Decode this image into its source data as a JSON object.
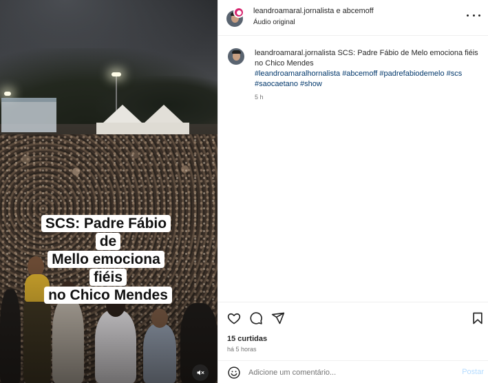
{
  "media": {
    "overlay_caption_lines": [
      "SCS: Padre Fábio de",
      "Mello emociona fiéis",
      "no Chico Mendes"
    ],
    "mute_icon": "speaker-muted-icon"
  },
  "header": {
    "authors": "leandroamaral.jornalista e abcemoff",
    "audio": "Áudio original",
    "more_icon": "more-horizontal-icon"
  },
  "post": {
    "username": "leandroamaral.jornalista",
    "text": "SCS: Padre Fábio de Melo emociona fiéis no Chico Mendes",
    "hashtags_line1": "#leandroamaralhornalista #abcemoff #padrefabiodemelo #scs",
    "hashtags_line2": "#saocaetano #show",
    "time": "5 h"
  },
  "actions": {
    "icons": [
      "heart-icon",
      "comment-icon",
      "share-icon",
      "bookmark-icon"
    ],
    "likes": "15 curtidas",
    "time_ago": "há 5 horas"
  },
  "comment": {
    "placeholder": "Adicione um comentário...",
    "post_label": "Postar",
    "emoji_icon": "emoji-icon"
  },
  "colors": {
    "link": "#00376b",
    "post_button_disabled": "#b3dbff",
    "muted_text": "#737373"
  }
}
